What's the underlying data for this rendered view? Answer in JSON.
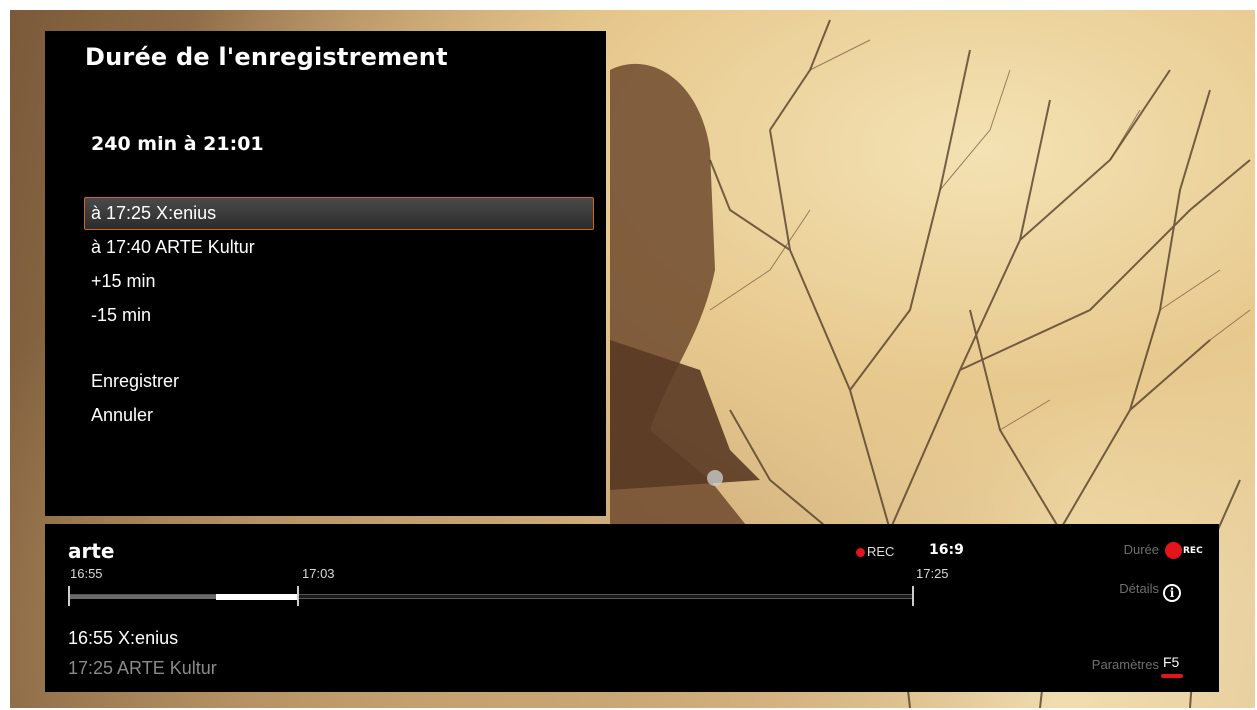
{
  "dialog": {
    "title": "Durée de l'enregistrement",
    "summary": "240 min à 21:01",
    "options": [
      {
        "label": "à 17:25 X:enius",
        "selected": true
      },
      {
        "label": "à 17:40 ARTE Kultur",
        "selected": false
      },
      {
        "label": "+15 min",
        "selected": false
      },
      {
        "label": "-15 min",
        "selected": false
      }
    ],
    "actions": {
      "record_label": "Enregistrer",
      "cancel_label": "Annuler"
    }
  },
  "infobar": {
    "channel": "arte",
    "timeline": {
      "start_label": "16:55",
      "now_label": "17:03",
      "end_label": "17:25"
    },
    "rec_status": "REC",
    "aspect_ratio": "16:9",
    "current_program": "16:55 X:enius",
    "next_program": "17:25 ARTE Kultur",
    "keys": {
      "duration_label": "Durée",
      "rec_badge": "REC",
      "details_label": "Détails",
      "info_glyph": "i",
      "settings_label": "Paramètres",
      "settings_key": "F5"
    }
  },
  "colors": {
    "accent_red": "#e3151b",
    "selection_border": "#c8652a",
    "panel_bg": "#000000"
  }
}
